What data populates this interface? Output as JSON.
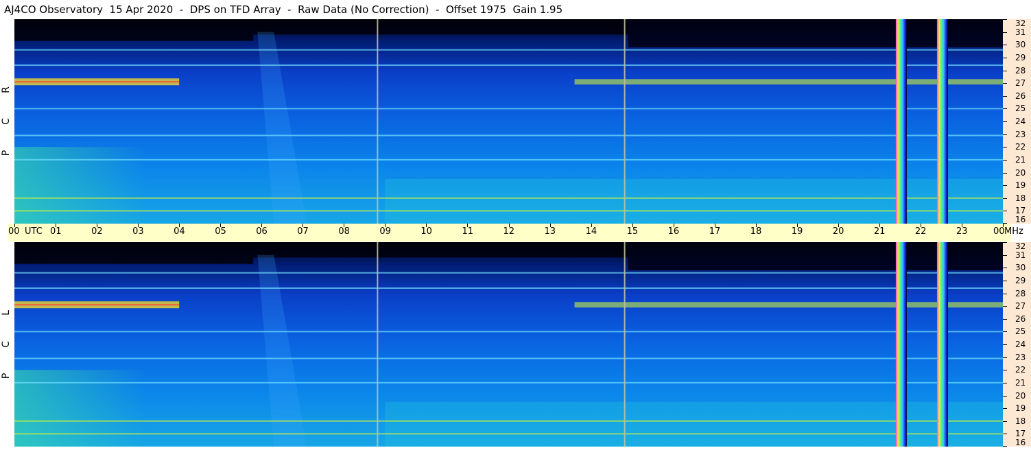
{
  "header": {
    "title": "AJ4CO Observatory  15 Apr 2020  -  DPS on TFD Array  -  Raw Data (No Correction)  -  Offset 1975  Gain 1.95"
  },
  "panels": [
    {
      "id": "rcp",
      "letters": [
        "R",
        "C",
        "P"
      ]
    },
    {
      "id": "lcp",
      "letters": [
        "L",
        "C",
        "P"
      ]
    }
  ],
  "xaxis": {
    "labels": [
      "00",
      "UTC",
      "01",
      "02",
      "03",
      "04",
      "05",
      "06",
      "07",
      "08",
      "09",
      "10",
      "11",
      "12",
      "13",
      "14",
      "15",
      "16",
      "17",
      "18",
      "19",
      "20",
      "21",
      "22",
      "23",
      "00",
      "MHz"
    ]
  },
  "yaxis": {
    "labels": [
      "32",
      "31",
      "30",
      "29",
      "28",
      "27",
      "26",
      "25",
      "24",
      "23",
      "22",
      "21",
      "20",
      "19",
      "18",
      "17",
      "16"
    ]
  },
  "chart_data": {
    "type": "heatmap",
    "title": "AJ4CO Observatory  15 Apr 2020  -  DPS on TFD Array  -  Raw Data (No Correction)  -  Offset 1975  Gain 1.95",
    "x_label": "UTC",
    "y_label": "MHz",
    "x_range": [
      0,
      24
    ],
    "y_range": [
      16,
      32
    ],
    "panels": [
      "R C P",
      "L C P"
    ],
    "x_ticks": [
      "00",
      "01",
      "02",
      "03",
      "04",
      "05",
      "06",
      "07",
      "08",
      "09",
      "10",
      "11",
      "12",
      "13",
      "14",
      "15",
      "16",
      "17",
      "18",
      "19",
      "20",
      "21",
      "22",
      "23",
      "00"
    ],
    "y_ticks": [
      16,
      17,
      18,
      19,
      20,
      21,
      22,
      23,
      24,
      25,
      26,
      27,
      28,
      29,
      30,
      31,
      32
    ],
    "colormap": [
      "#000000",
      "#001a6e",
      "#0a3fc8",
      "#0b84ea",
      "#17c0d8",
      "#40e0a0",
      "#c8f040",
      "#ffe020",
      "#ff4040"
    ],
    "features": {
      "vertical_lines_utc": [
        8.8,
        14.8
      ],
      "broadband_bursts_utc": [
        21.4,
        22.4
      ],
      "strong_band_mhz": 27.1,
      "interference_bands_mhz": [
        29.6,
        28.4,
        25.0,
        22.9,
        21.0,
        18.0,
        17.0
      ]
    }
  }
}
